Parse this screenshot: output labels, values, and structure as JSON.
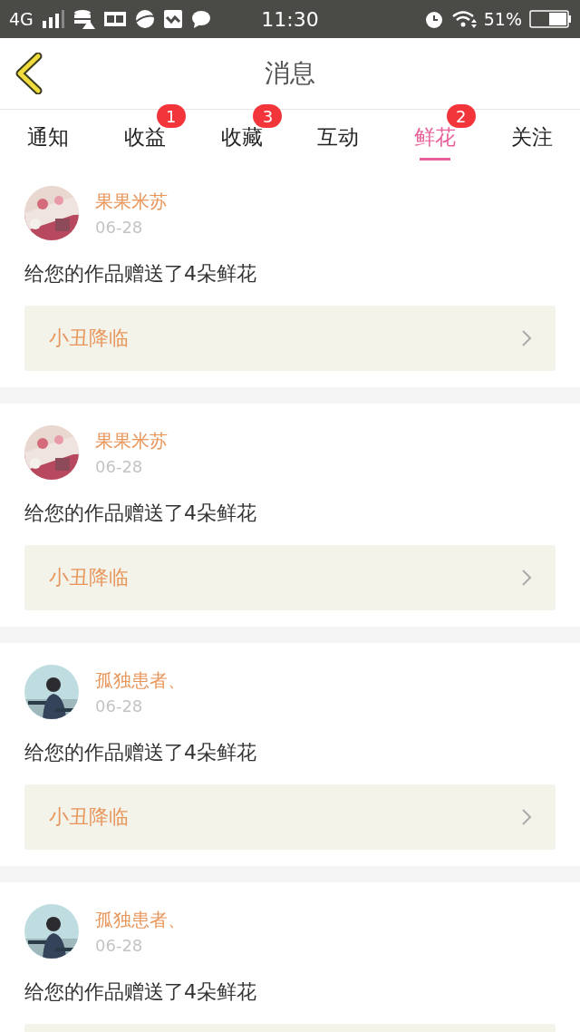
{
  "status_bar": {
    "network": "4G",
    "time": "11:30",
    "battery": "51%"
  },
  "header": {
    "title": "消息"
  },
  "tabs": [
    {
      "label": "通知",
      "selected": false
    },
    {
      "label": "收益",
      "selected": false,
      "badge": "1"
    },
    {
      "label": "收藏",
      "selected": false,
      "badge": "3"
    },
    {
      "label": "互动",
      "selected": false
    },
    {
      "label": "鲜花",
      "selected": true,
      "badge": "2"
    },
    {
      "label": "关注",
      "selected": false
    }
  ],
  "messages": [
    {
      "name": "果果米苏",
      "date": "06-28",
      "text": "给您的作品赠送了4朵鲜花",
      "work": "小丑降临"
    },
    {
      "name": "果果米苏",
      "date": "06-28",
      "text": "给您的作品赠送了4朵鲜花",
      "work": "小丑降临"
    },
    {
      "name": "孤独患者、",
      "date": "06-28",
      "text": "给您的作品赠送了4朵鲜花",
      "work": "小丑降临"
    },
    {
      "name": "孤独患者、",
      "date": "06-28",
      "text": "给您的作品赠送了4朵鲜花"
    }
  ]
}
